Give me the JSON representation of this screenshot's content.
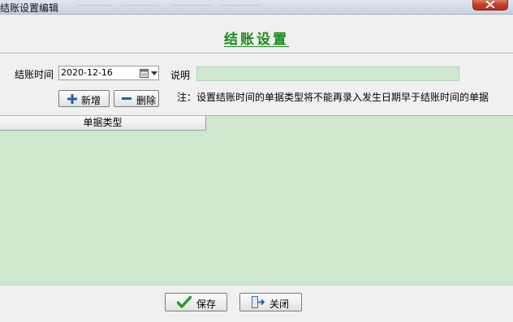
{
  "window": {
    "title": "结账设置编辑"
  },
  "heading": "结账设置",
  "form": {
    "close_time_label": "结账时间",
    "close_time_value": "2020-12-16",
    "remark_label": "说明",
    "remark_value": "",
    "note": "注：设置结账时间的单据类型将不能再录入发生日期早于结账时间的单据"
  },
  "toolbar": {
    "add_label": "新增",
    "delete_label": "删除"
  },
  "grid": {
    "columns": [
      "单据类型"
    ],
    "rows": []
  },
  "footer": {
    "save_label": "保存",
    "close_label": "关闭"
  },
  "colors": {
    "heading": "#1e8a1e",
    "grid_bg": "#cfe8cf",
    "icon_blue": "#1f5fb5",
    "check_green": "#2e9b2e"
  },
  "icons": [
    "close-icon",
    "calendar-icon",
    "dropdown-arrow-icon",
    "plus-icon",
    "minus-icon",
    "check-icon",
    "exit-door-icon"
  ]
}
